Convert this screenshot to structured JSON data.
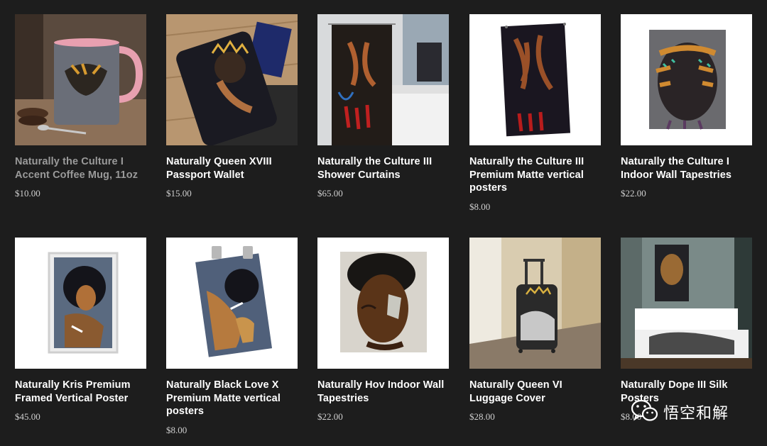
{
  "products": [
    {
      "title": "Naturally the Culture I Accent Coffee Mug, 11oz",
      "price": "$10.00",
      "muted": true
    },
    {
      "title": "Naturally Queen XVIII Passport Wallet",
      "price": "$15.00"
    },
    {
      "title": "Naturally the Culture III Shower Curtains",
      "price": "$65.00"
    },
    {
      "title": "Naturally the Culture III Premium Matte vertical posters",
      "price": "$8.00"
    },
    {
      "title": "Naturally the Culture I Indoor Wall Tapestries",
      "price": "$22.00"
    },
    {
      "title": "Naturally Kris Premium Framed Vertical Poster",
      "price": "$45.00"
    },
    {
      "title": "Naturally Black Love X Premium Matte vertical posters",
      "price": "$8.00"
    },
    {
      "title": "Naturally Hov Indoor Wall Tapestries",
      "price": "$22.00"
    },
    {
      "title": "Naturally Queen VI Luggage Cover",
      "price": "$28.00"
    },
    {
      "title": "Naturally Dope III Silk Posters",
      "price": "$8.00"
    }
  ],
  "watermark": {
    "text": "悟空和解",
    "icon": "wechat-icon"
  },
  "colors": {
    "background": "#1d1d1d",
    "title": "#ffffff",
    "title_muted": "#9a9a9a",
    "price": "#cfcfcf"
  }
}
